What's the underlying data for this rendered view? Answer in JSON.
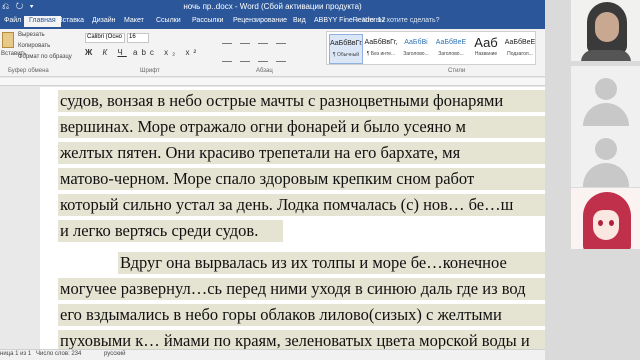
{
  "titlebar": {
    "quick_access": "⎌ ↻ ▾",
    "title": "ночь пр..docx - Word (Сбой активации продукта)"
  },
  "tabs": [
    {
      "label": "Файл"
    },
    {
      "label": "Главная"
    },
    {
      "label": "Вставка"
    },
    {
      "label": "Дизайн"
    },
    {
      "label": "Макет"
    },
    {
      "label": "Ссылки"
    },
    {
      "label": "Рассылки"
    },
    {
      "label": "Рецензирование"
    },
    {
      "label": "Вид"
    },
    {
      "label": "ABBYY FineReader 12"
    }
  ],
  "tell_me": "♀ Что вы хотите сделать?",
  "ribbon": {
    "clipboard": {
      "paste_label": "Вставить",
      "cut": "Вырезать",
      "copy": "Копировать",
      "format_painter": "Формат по образцу",
      "group_label": "Буфер обмена"
    },
    "font": {
      "name": "Calibri (Осно",
      "size": "16",
      "group_label": "Шрифт"
    },
    "paragraph": {
      "group_label": "Абзац"
    },
    "styles": {
      "group_label": "Стили",
      "items": [
        {
          "preview": "АаБбВвГг,",
          "name": "¶ Обычный"
        },
        {
          "preview": "АаБбВвГг,",
          "name": "¶ Без инте..."
        },
        {
          "preview": "АаБбВі",
          "name": "Заголово..."
        },
        {
          "preview": "АаБбВеЕ",
          "name": "Заголово..."
        },
        {
          "preview": "Ааб",
          "name": "Название"
        },
        {
          "preview": "АаБбВеЕ",
          "name": "Подзагол..."
        }
      ]
    }
  },
  "document": {
    "lines": [
      "судов, вонзая в небо острые мачты с разноцветными фонарями",
      "вершинах. Море отражало огни фонарей и было усеяно м",
      "желтых пятен. Они красиво трепетали на его бархате, мя",
      "матово-черном. Море спало здоровым крепким сном работ",
      "который сильно устал за день. Лодка помчалась (с) нов… бе…ш",
      "и легко вертясь среди судов.",
      "Вдруг она вырвалась из их толпы и море  бе…конечное",
      "могучее  развернул…сь перед ними уходя в синюю даль  где из вод",
      "его вздымались в небо горы облаков  лилово(сизых)  с желтыми",
      "пуховыми к… ймами по краям, зеленоватых цвета морской воды и"
    ]
  },
  "status_bar": {
    "page": "ница 1 из 1",
    "word_count": "Число слов: 234",
    "language": "русский"
  }
}
